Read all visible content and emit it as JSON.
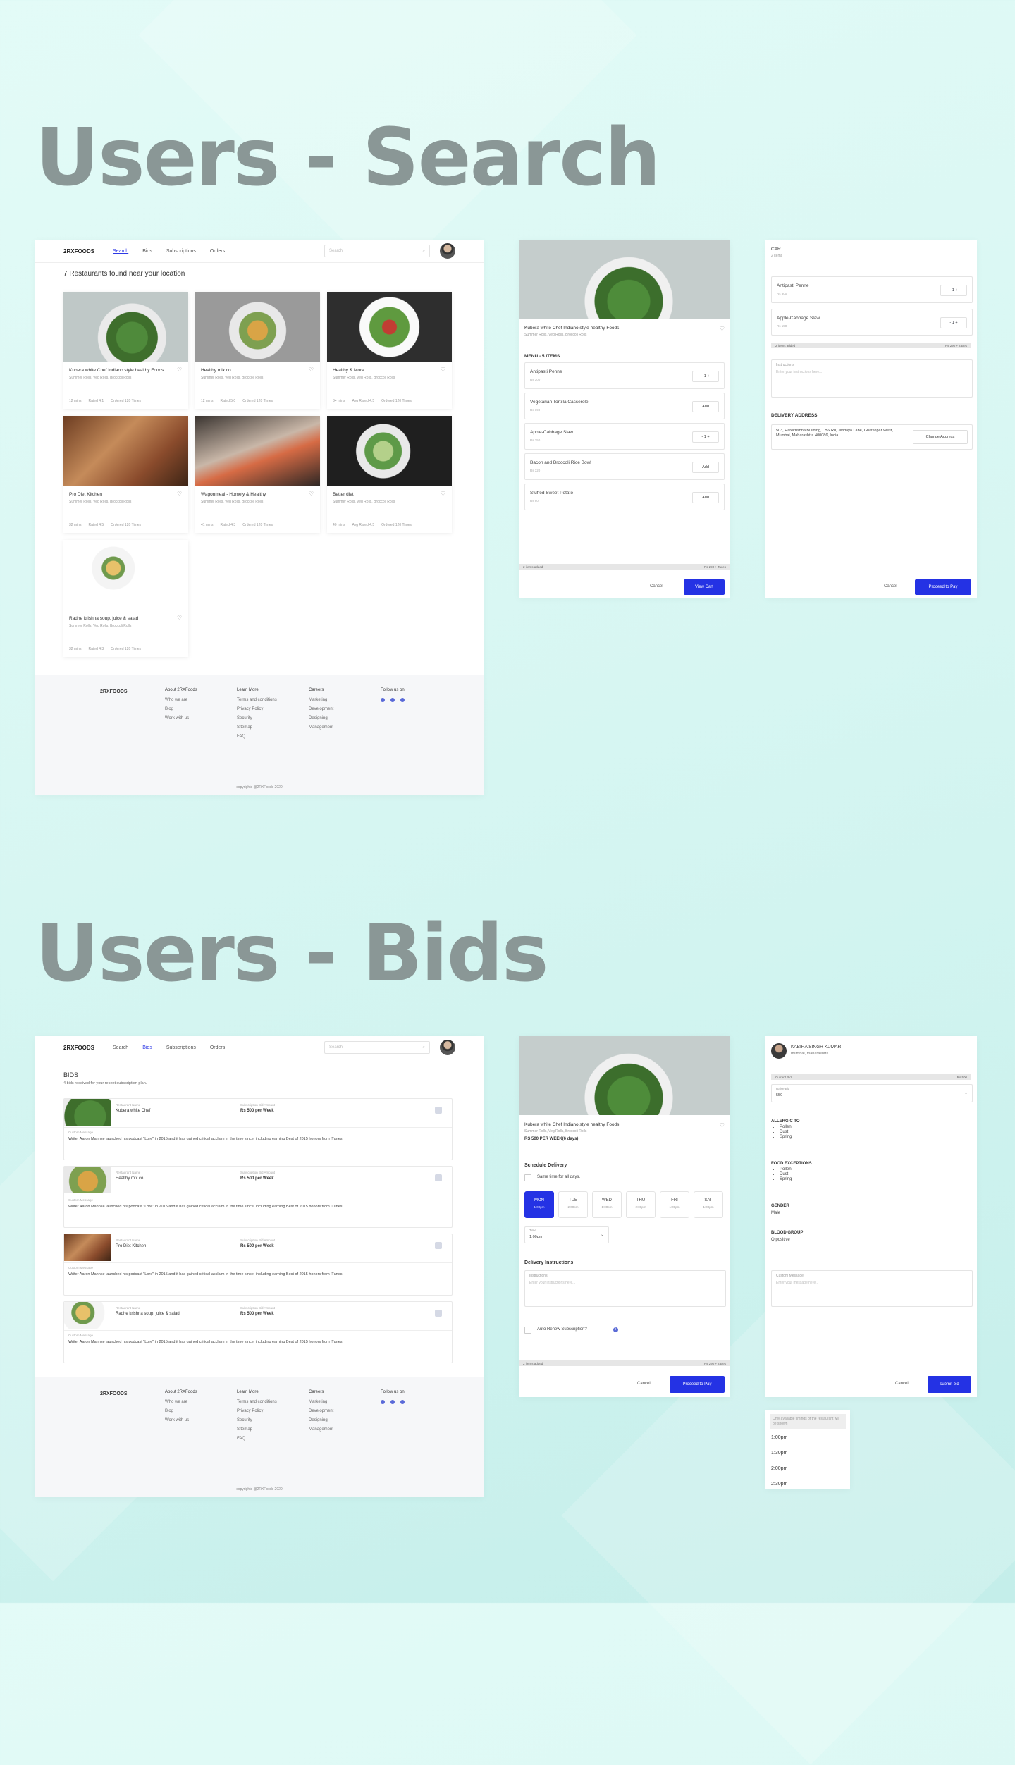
{
  "titles": {
    "search": "Users - Search",
    "bids": "Users - Bids"
  },
  "nav": {
    "logo": "2RXFOODS",
    "links": [
      "Search",
      "Bids",
      "Subscriptions",
      "Orders"
    ],
    "search_placeholder": "Search"
  },
  "search_page": {
    "heading": "7 Restaurants found near your location",
    "restaurants": [
      {
        "name": "Kubera white Chef Indiano style healthy Foods",
        "tags": "Summer Rolls, Veg Rolls, Broccoli Rolls",
        "time": "12 mins",
        "rated": "Rated 4.1",
        "ordered": "Ordered 120 Times"
      },
      {
        "name": "Healthy mix co.",
        "tags": "Summer Rolls, Veg Rolls, Broccoli Rolls",
        "time": "12 mins",
        "rated": "Rated 5.0",
        "ordered": "Ordered 120 Times"
      },
      {
        "name": "Healthy & More",
        "tags": "Summer Rolls, Veg Rolls, Broccoli Rolls",
        "time": "34 mins",
        "rated": "Avg Rated 4.5",
        "ordered": "Ordered 120 Times"
      },
      {
        "name": "Pro Diet Kitchen",
        "tags": "Summer Rolls, Veg Rolls, Broccoli Rolls",
        "time": "32 mins",
        "rated": "Rated 4.5",
        "ordered": "Ordered 120 Times"
      },
      {
        "name": "Wagonmeal - Homely & Healthy",
        "tags": "Summer Rolls, Veg Rolls, Broccoli Rolls",
        "time": "41 mins",
        "rated": "Rated 4.3",
        "ordered": "Ordered 120 Times"
      },
      {
        "name": "Better diet",
        "tags": "Summer Rolls, Veg Rolls, Broccoli Rolls",
        "time": "40 mins",
        "rated": "Avg Rated 4.5",
        "ordered": "Ordered 120 Times"
      },
      {
        "name": "Radhe krishna soup, juice & salad",
        "tags": "Summer Rolls, Veg Rolls, Broccoli Rolls",
        "time": "32 mins",
        "rated": "Rated 4.3",
        "ordered": "Ordered 120 Times"
      }
    ]
  },
  "footer": {
    "logo": "2RXFOODS",
    "cols": [
      {
        "head": "About 2RXFoods",
        "items": [
          "Who we are",
          "Blog",
          "Work with us"
        ]
      },
      {
        "head": "Learn More",
        "items": [
          "Terms and conditions",
          "Privacy Policy",
          "Security",
          "Sitemap",
          "FAQ"
        ]
      },
      {
        "head": "Careers",
        "items": [
          "Marketing",
          "Development",
          "Designing",
          "Management"
        ]
      },
      {
        "head": "Follow us on",
        "items": []
      }
    ],
    "copyright": "copyrights @2RXFoods 2020"
  },
  "menu_panel": {
    "title": "Kubera white Chef Indiano style healthy Foods",
    "tags": "Summer Rolls, Veg Rolls, Broccoli Rolls",
    "menu_heading": "MENU - 5 ITEMS",
    "items": [
      {
        "name": "Antipasti Penne",
        "price": "Rs 300",
        "action": "- 1 +"
      },
      {
        "name": "Vegetarian Tortilla Casserole",
        "price": "Rs 190",
        "action": "Add"
      },
      {
        "name": "Apple-Cabbage Slaw",
        "price": "Rs 150",
        "action": "- 1 +"
      },
      {
        "name": "Bacon and Broccoli Rice Bowl",
        "price": "Rs 320",
        "action": "Add"
      },
      {
        "name": "Stuffed Sweet Potato",
        "price": "Rs 90",
        "action": "Add"
      }
    ],
    "summary_left": "2 items added",
    "summary_right": "Rs 290 + Taxes",
    "cancel": "Cancel",
    "primary": "View Cart"
  },
  "cart_panel": {
    "title": "CART",
    "count": "2 items",
    "items": [
      {
        "name": "Antipasti Penne",
        "price": "Rs 300",
        "qty": "- 1 +"
      },
      {
        "name": "Apple-Cabbage Slaw",
        "price": "Rs 150",
        "qty": "- 1 +"
      }
    ],
    "summary_left": "2 items added",
    "summary_right": "Rs 290 + Taxes",
    "instructions_label": "Instructions",
    "instructions_placeholder": "Enter your instructions here...",
    "address_heading": "DELIVERY ADDRESS",
    "address": "503, Harekrishna Building, LBS Rd, Jividaya Lane, Ghatkopar West, Mumbai, Maharashtra 400086, India",
    "change_address": "Change Address",
    "cancel": "Cancel",
    "primary": "Proceed to Pay"
  },
  "bids_page": {
    "heading": "BIDS",
    "subheading": "4 bids received for your recent subscription plan.",
    "rest_label": "Restaurant Name",
    "amount_label": "Subscription Bid Amount",
    "msg_label": "Custom Message",
    "message": "Writer Aaron Mahnke launched his podcast \"Lore\" in 2015 and it has gained critical acclaim in the time since, including earning Best of 2015 honors from iTunes.",
    "bids": [
      {
        "name": "Kubera white Chef",
        "amount": "Rs 500 per Week"
      },
      {
        "name": "Healthy mix co.",
        "amount": "Rs 500 per Week"
      },
      {
        "name": "Pro Diet Kitchen",
        "amount": "Rs 500 per Week"
      },
      {
        "name": "Radhe krishna soup, juice & salad",
        "amount": "Rs 500 per Week"
      }
    ]
  },
  "schedule_panel": {
    "title": "Kubera white Chef Indiano style healthy Foods",
    "tags": "Summer Rolls, Veg Rolls, Broccoli Rolls",
    "price": "RS 500 PER WEEK(6 days)",
    "schedule_heading": "Schedule Delivery",
    "same_time": "Same time for all days.",
    "days": [
      {
        "d": "MON",
        "t": "1:00pm"
      },
      {
        "d": "TUE",
        "t": "2:00pm"
      },
      {
        "d": "WED",
        "t": "1:00pm"
      },
      {
        "d": "THU",
        "t": "2:00pm"
      },
      {
        "d": "FRI",
        "t": "1:00pm"
      },
      {
        "d": "SAT",
        "t": "1:00pm"
      }
    ],
    "time_label": "Time",
    "time_value": "1:00pm",
    "instructions_heading": "Delivery Instructions",
    "instructions_label": "Instructions",
    "instructions_placeholder": "Enter your instructions here...",
    "auto_renew": "Auto Renew Subscription?",
    "summary_left": "2 items added",
    "summary_right": "Rs 290 + Taxes",
    "cancel": "Cancel",
    "primary": "Proceed to Pay"
  },
  "profile_panel": {
    "name": "KABIRA SINGH KUMAR",
    "location": "mumbai, maharashtra",
    "current_bid_label": "Current Bid",
    "current_bid_value": "Rs 500",
    "raise_label": "Raise Bid",
    "raise_value": "550",
    "allergic_heading": "ALLERGIC TO",
    "allergic": [
      "Pollen",
      "Dust",
      "Spring"
    ],
    "exceptions_heading": "FOOD EXCEPTIONS",
    "exceptions": [
      "Pollen",
      "Dust",
      "Spring"
    ],
    "gender_heading": "GENDER",
    "gender": "Male",
    "blood_heading": "BLOOD GROUP",
    "blood": "O positive",
    "custom_label": "Custom Message",
    "custom_placeholder": "Enter your message here...",
    "cancel": "Cancel",
    "primary": "submit bid"
  },
  "time_dropdown": {
    "note": "Only available timings of the restaurant will be shown",
    "options": [
      "1:00pm",
      "1:30pm",
      "2:00pm",
      "2:30pm"
    ]
  },
  "colors": {
    "accent": "#2432e4",
    "title": "#8a9796",
    "background": "#d9f7f3"
  }
}
